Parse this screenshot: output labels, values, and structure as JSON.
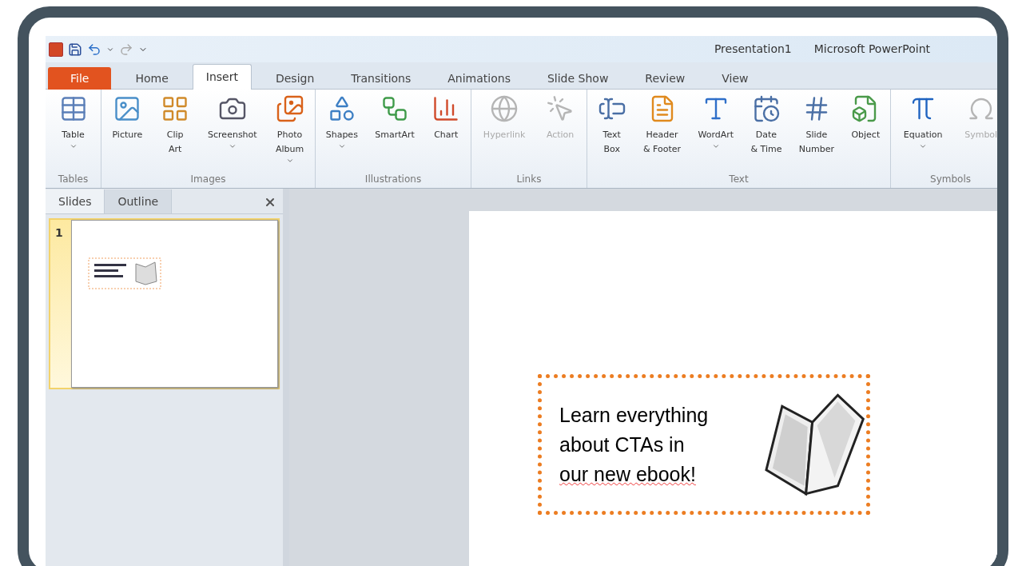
{
  "window": {
    "document": "Presentation1",
    "app": "Microsoft PowerPoint"
  },
  "ribbon_tabs": [
    {
      "label": "File",
      "kind": "file",
      "selected": false
    },
    {
      "label": "Home",
      "kind": "tab",
      "selected": false
    },
    {
      "label": "Insert",
      "kind": "tab",
      "selected": true
    },
    {
      "label": "Design",
      "kind": "tab",
      "selected": false
    },
    {
      "label": "Transitions",
      "kind": "tab",
      "selected": false
    },
    {
      "label": "Animations",
      "kind": "tab",
      "selected": false
    },
    {
      "label": "Slide Show",
      "kind": "tab",
      "selected": false
    },
    {
      "label": "Review",
      "kind": "tab",
      "selected": false
    },
    {
      "label": "View",
      "kind": "tab",
      "selected": false
    }
  ],
  "ribbon_groups": [
    {
      "label": "Tables",
      "items": [
        {
          "label": [
            "Table"
          ],
          "dropdown": true,
          "disabled": false
        }
      ]
    },
    {
      "label": "Images",
      "items": [
        {
          "label": [
            "Picture"
          ],
          "dropdown": false,
          "disabled": false
        },
        {
          "label": [
            "Clip",
            "Art"
          ],
          "dropdown": false,
          "disabled": false
        },
        {
          "label": [
            "Screenshot"
          ],
          "dropdown": true,
          "disabled": false
        },
        {
          "label": [
            "Photo",
            "Album"
          ],
          "dropdown": true,
          "disabled": false
        }
      ]
    },
    {
      "label": "Illustrations",
      "items": [
        {
          "label": [
            "Shapes"
          ],
          "dropdown": true,
          "disabled": false
        },
        {
          "label": [
            "SmartArt"
          ],
          "dropdown": false,
          "disabled": false
        },
        {
          "label": [
            "Chart"
          ],
          "dropdown": false,
          "disabled": false
        }
      ]
    },
    {
      "label": "Links",
      "items": [
        {
          "label": [
            "Hyperlink"
          ],
          "dropdown": false,
          "disabled": true
        },
        {
          "label": [
            "Action"
          ],
          "dropdown": false,
          "disabled": true
        }
      ]
    },
    {
      "label": "Text",
      "items": [
        {
          "label": [
            "Text",
            "Box"
          ],
          "dropdown": false,
          "disabled": false
        },
        {
          "label": [
            "Header",
            "& Footer"
          ],
          "dropdown": false,
          "disabled": false
        },
        {
          "label": [
            "WordArt"
          ],
          "dropdown": true,
          "disabled": false
        },
        {
          "label": [
            "Date",
            "& Time"
          ],
          "dropdown": false,
          "disabled": false
        },
        {
          "label": [
            "Slide",
            "Number"
          ],
          "dropdown": false,
          "disabled": false
        },
        {
          "label": [
            "Object"
          ],
          "dropdown": false,
          "disabled": false
        }
      ]
    },
    {
      "label": "Symbols",
      "items": [
        {
          "label": [
            "Equation"
          ],
          "dropdown": true,
          "disabled": false
        },
        {
          "label": [
            "Symbol"
          ],
          "dropdown": false,
          "disabled": true
        }
      ]
    }
  ],
  "slides_pane": {
    "tabs": [
      {
        "label": "Slides",
        "selected": true
      },
      {
        "label": "Outline",
        "selected": false
      }
    ],
    "thumbnails": [
      {
        "number": "1",
        "selected": true
      }
    ]
  },
  "slide": {
    "text_box": {
      "lines": [
        "Learn everything",
        "about CTAs in",
        "our new ebook!"
      ]
    }
  }
}
